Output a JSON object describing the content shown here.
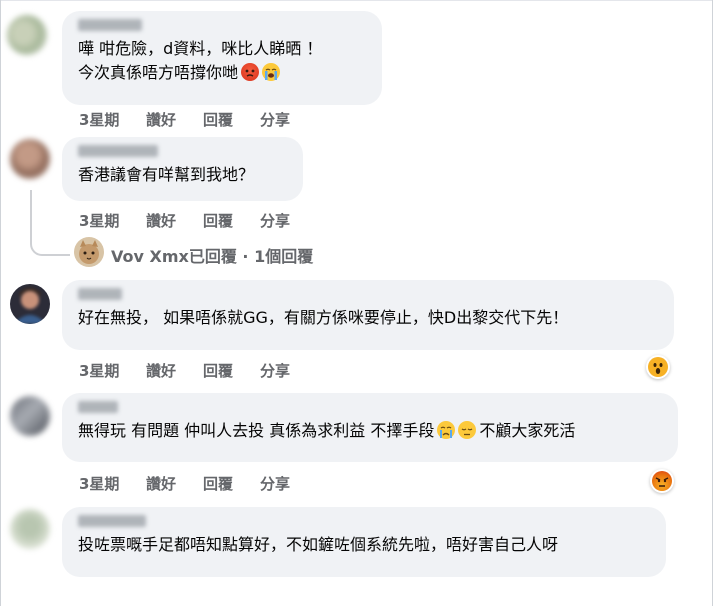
{
  "comments": [
    {
      "lines": [
        "嘩 咁危險，d資料，咪比人睇晒 ！",
        "今次真係唔方唔撐你哋"
      ],
      "emojis": [
        "angry-face-emoji",
        "loudly-crying-face-emoji"
      ],
      "actions": {
        "time": "3星期",
        "like": "讚好",
        "reply": "回覆",
        "share": "分享"
      }
    },
    {
      "lines": [
        "香港議會有咩幫到我地？"
      ],
      "actions": {
        "time": "3星期",
        "like": "讚好",
        "reply": "回覆",
        "share": "分享"
      },
      "replies": {
        "name": "Vov Xmx已回覆",
        "sep": "·",
        "count": "1個回覆"
      }
    },
    {
      "lines": [
        "好在無投， 如果唔係就GG，有關方係咪要停止，快D出黎交代下先！"
      ],
      "reaction": "wow-reaction",
      "actions": {
        "time": "3星期",
        "like": "讚好",
        "reply": "回覆",
        "share": "分享"
      }
    },
    {
      "lines": [
        "無得玩 有問題 仲叫人去投 真係為求利益 不擇手段",
        "不顧大家死活"
      ],
      "emojis": [
        "crying-face-emoji",
        "pensive-face-emoji"
      ],
      "reaction": "angry-reaction",
      "actions": {
        "time": "3星期",
        "like": "讚好",
        "reply": "回覆",
        "share": "分享"
      }
    },
    {
      "lines": [
        "投咗票嘅手足都唔知點算好，不如鏟咗個系統先啦，唔好害自己人呀"
      ],
      "actions": {
        "time": "3星期",
        "like": "讚好",
        "reply": "回覆",
        "share": "分享"
      }
    }
  ],
  "colors": {
    "bubble": "#f0f2f5",
    "secondary_text": "#65676b",
    "angry": "#e9710f",
    "wow": "#f7b125"
  }
}
